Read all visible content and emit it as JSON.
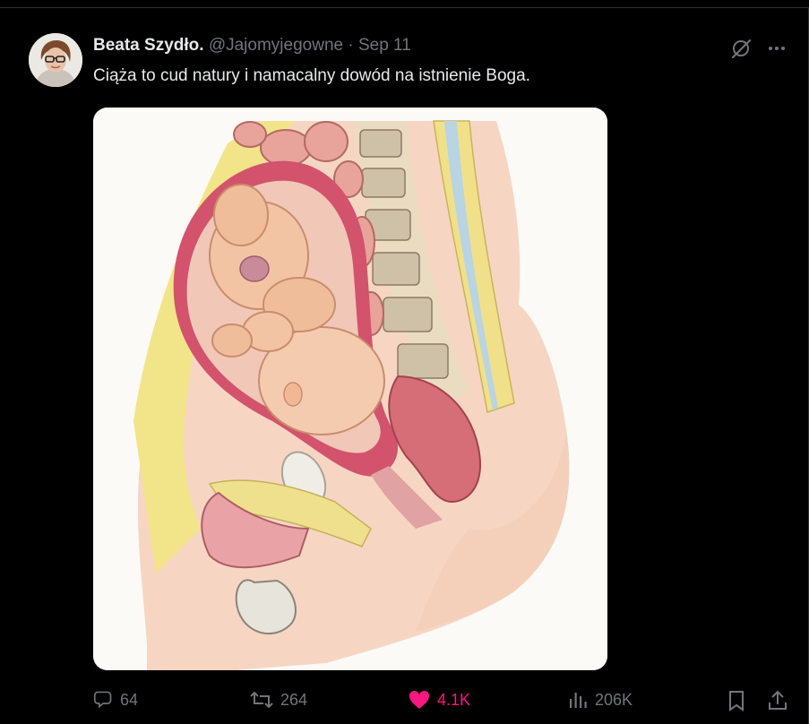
{
  "author": {
    "display_name": "Beata Szydło.",
    "handle": "@Jajomyjegowne",
    "separator": "·",
    "date": "Sep 11"
  },
  "tweet": {
    "text": "Ciąża to cud natury i namacalny dowód na istnienie Boga."
  },
  "top_icons": [
    "grok-icon",
    "more-icon"
  ],
  "media": {
    "description_icon": "anatomical-illustration"
  },
  "actions": {
    "replies": "64",
    "reposts": "264",
    "likes": "4.1K",
    "views": "206K"
  },
  "colors": {
    "background": "#000000",
    "text_primary": "#e7e9ea",
    "text_secondary": "#71767b",
    "like_accent": "#f91880",
    "border": "#2f3336"
  }
}
